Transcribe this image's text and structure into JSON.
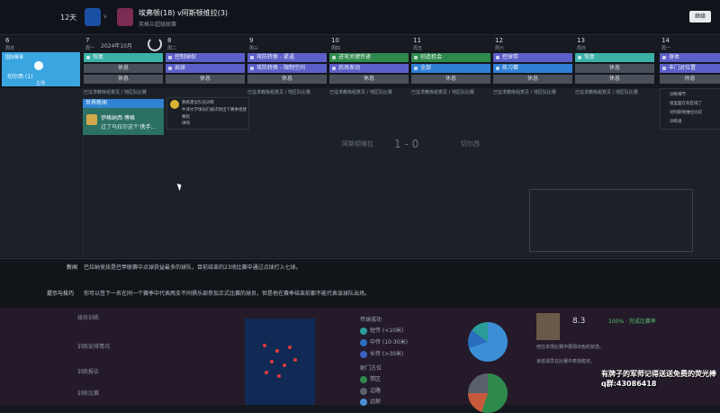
{
  "topbar": {
    "days": "12天",
    "home": "埃弗顿",
    "home_rank": "(18)",
    "vs": "v",
    "away": "阿斯顿维拉",
    "away_rank": "(3)",
    "match_title": "埃弗顿(18) v阿斯顿维拉(3)",
    "competition": "英格兰超级联赛",
    "continue": "继续"
  },
  "calendar": {
    "month": "2024年10月",
    "days": [
      {
        "num": "6",
        "wd": "周日"
      },
      {
        "num": "7",
        "wd": "周一"
      },
      {
        "num": "8",
        "wd": "周二"
      },
      {
        "num": "9",
        "wd": "周三"
      },
      {
        "num": "10",
        "wd": "周四"
      },
      {
        "num": "11",
        "wd": "周五"
      },
      {
        "num": "12",
        "wd": "周六"
      },
      {
        "num": "13",
        "wd": "周日"
      },
      {
        "num": "14",
        "wd": "周一"
      }
    ],
    "selected": {
      "l1": "国际赛事",
      "l2": "切尔西 (1)",
      "l3": "主场"
    },
    "slots": {
      "mon": [
        "恢复",
        "休息",
        "休息"
      ],
      "tue": [
        "控制球权",
        "出球",
        "休息"
      ],
      "wed": [
        "攻防转换 - 紧逼",
        "攻防转换 - 限制空间",
        "休息"
      ],
      "thu": [
        "进攻关键传递",
        "后场发动",
        "休息"
      ],
      "fri": [
        "创造机会",
        "全部",
        "休息"
      ],
      "sat": [
        "控球带",
        "练习赛",
        "休息"
      ],
      "sun": [
        "恢复",
        "休息",
        "休息"
      ],
      "mon2": [
        "身体",
        "丰门对位置",
        "休息"
      ]
    },
    "instr": "已征求教练组意见 / 地区队比赛",
    "news_head": "世界新闻",
    "news_t1": "伊格纳西·博格",
    "news_t2": "过了马拉尔这个'携手...",
    "msg1": [
      "教练建议队伍训练",
      "牛津大学球员们被识别出下赛季组建",
      "赛程",
      "球场"
    ],
    "msg2": [
      "训练细节",
      "组里面在有区域了",
      "对阿斯顿维拉比较",
      "训练组"
    ]
  },
  "ghost": {
    "team_l": "阿斯顿维拉",
    "score": "1 - 0",
    "team_r": "切尔西"
  },
  "info": {
    "news_label": "新闻",
    "news_text": "巴拉纳竞技是巴甲联赛中点球获益最多的球队，目前结束的23场比赛中通过点球打入七球。",
    "tips_label": "提示与技巧",
    "tips_text": "你可以签下一名在同一个赛季中代表两支不同俱乐部参加正式比赛的球员，但是他在赛季结束前都不能代表该球队出场。"
  },
  "bottom": {
    "left_items": [
      "球员训练",
      "训练安排情况",
      "训练报告",
      "训练比赛"
    ],
    "legend_title": "传球成功",
    "legend": [
      "短传 (<10米)",
      "中传 (10-30米)",
      "长传 (>30米)"
    ],
    "legend2_title": "射门方位",
    "legend2": [
      "禁区",
      "边路",
      "远射"
    ],
    "rating": "8.3",
    "rating_pct": "100% · 完成比赛率",
    "player_lines": [
      "他在本场比赛中展现出色的状态。",
      "该名球员在比赛中表现稳定。"
    ],
    "overlay1": "有牌子的军师记得送送免费的荧光棒",
    "overlay2": "q群:43086418",
    "colors": {
      "legend": [
        "#2a9d9a",
        "#2a6fbd",
        "#3a5fbf"
      ],
      "legend2": [
        "#2e8a4c",
        "#5a616c",
        "#4a8fd6"
      ]
    }
  }
}
